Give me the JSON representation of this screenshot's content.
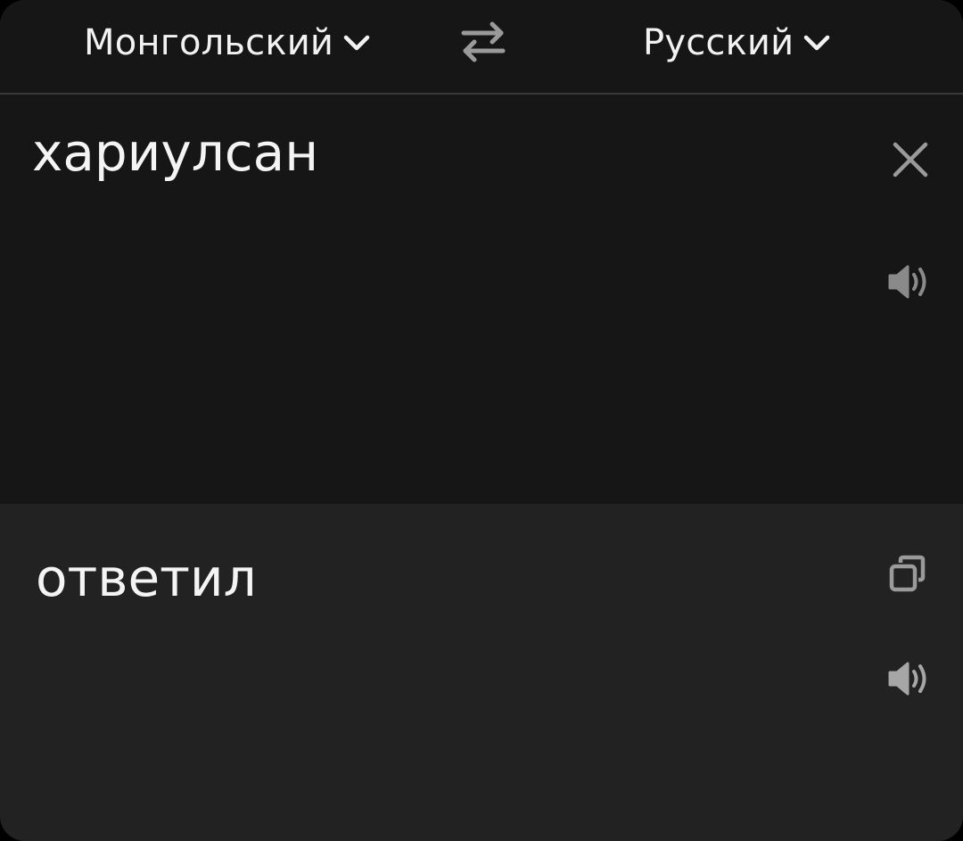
{
  "languages": {
    "source_label": "Монгольский",
    "target_label": "Русский"
  },
  "source": {
    "text": "хариулсан"
  },
  "result": {
    "text": "ответил"
  },
  "icons": {
    "dropdown": "chevron-down-icon",
    "swap": "swap-arrows-icon",
    "clear": "close-icon",
    "speak": "speaker-icon",
    "copy": "copy-icon"
  },
  "colors": {
    "background": "#161616",
    "result_background": "#222222",
    "text": "#f4f4f4",
    "icon": "#9a9a9a"
  }
}
